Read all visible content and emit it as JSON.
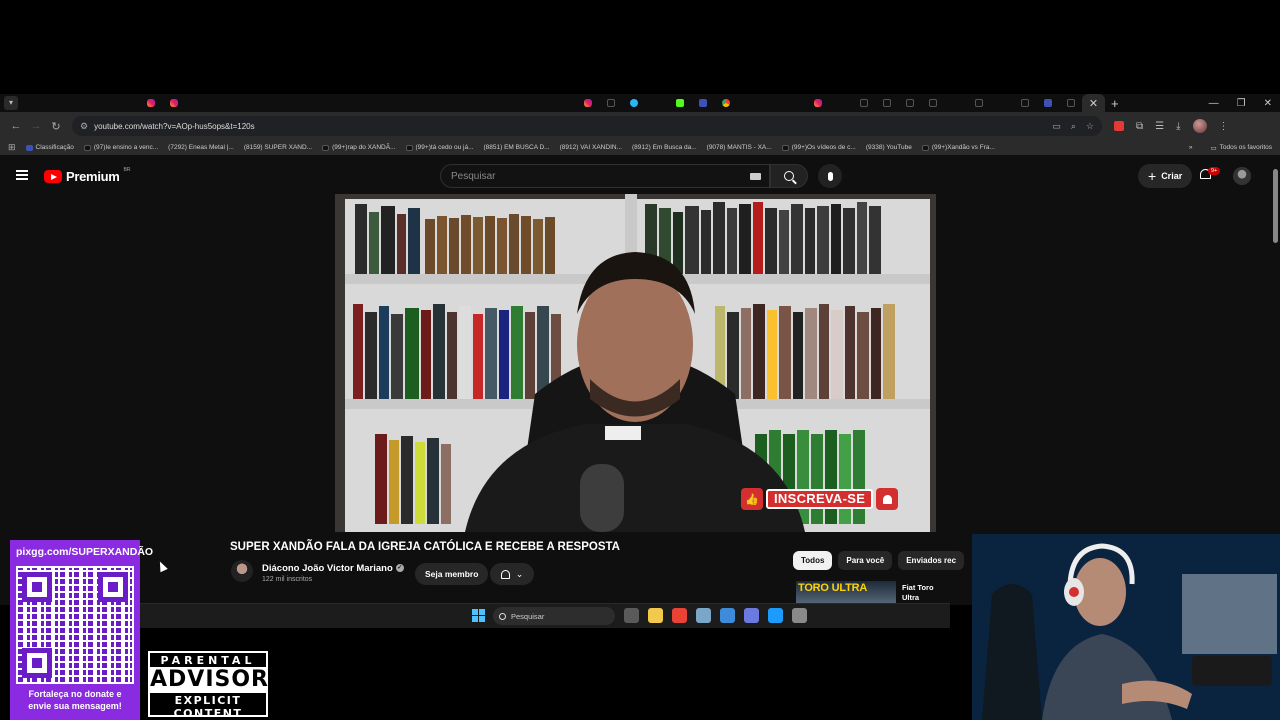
{
  "browser": {
    "tabs": [
      "yt",
      "yt",
      "yt",
      "yt",
      "yt",
      "ig",
      "ig",
      "yt",
      "yt",
      "yt",
      "yt",
      "yt",
      "yt",
      "yt",
      "yt",
      "yt",
      "yt",
      "yt",
      "yt",
      "yt",
      "yt",
      "yt",
      "yt",
      "yt",
      "ig",
      "tk",
      "tg",
      "yt",
      "kk",
      "bl",
      "cr",
      "yt",
      "yt",
      "yt",
      "ig",
      "yt",
      "tk",
      "tk",
      "tk",
      "tk",
      "yt",
      "tk",
      "yt",
      "tk",
      "bl",
      "tk"
    ],
    "url": "youtube.com/watch?v=AOp-hus5ops&t=120s",
    "bookmarks": [
      {
        "icon": "bl",
        "label": "Classificação"
      },
      {
        "icon": "tk",
        "label": "(97)Ie ensino a venc..."
      },
      {
        "icon": "yt",
        "label": "(7292) Eneas Metal |..."
      },
      {
        "icon": "yt",
        "label": "(8159) SUPER XAND..."
      },
      {
        "icon": "tk",
        "label": "(99+)rap do XANDÃ..."
      },
      {
        "icon": "tk",
        "label": "(99+)tá cedo ou já..."
      },
      {
        "icon": "yt",
        "label": "(8851) EM BUSCA D..."
      },
      {
        "icon": "yt",
        "label": "(8912) VAI XANDIN..."
      },
      {
        "icon": "yt",
        "label": "(8912) Em Busca da..."
      },
      {
        "icon": "yt",
        "label": "(9078) MANTIS - XA..."
      },
      {
        "icon": "tk",
        "label": "(99+)Os vídeos de c..."
      },
      {
        "icon": "yt",
        "label": "(9338) YouTube"
      },
      {
        "icon": "tk",
        "label": "(99+)Xandão vs Fra..."
      }
    ],
    "all_bookmarks_label": "Todos os favoritos",
    "overflow": "»"
  },
  "youtube": {
    "logo_text": "Premium",
    "logo_sup": "BR",
    "search_placeholder": "Pesquisar",
    "create_label": "Criar",
    "notif_count": "9+",
    "subscribe_overlay": "INSCREVA-SE",
    "video_title": "SUPER XANDÃO FALA DA IGREJA CATÓLICA E RECEBE A RESPOSTA",
    "channel_name": "Diácono João Victor Mariano",
    "channel_subs": "122 mil inscritos",
    "member_label": "Seja membro",
    "chips": [
      "Todos",
      "Para você",
      "Enviados rec"
    ],
    "rec_thumb_text": "TORO ULTRA",
    "rec_title": "Fiat Toro Ultra RAMPAGE o"
  },
  "taskbar": {
    "search_placeholder": "Pesquisar",
    "icons": [
      "#5a5a5a",
      "#f2c94c",
      "#ea4335",
      "#7aa7c7",
      "#3d8bd9",
      "#6c7ae0",
      "#1b9cfc",
      "#8a8a8a"
    ]
  },
  "overlay": {
    "donate_url": "pixgg.com/SUPERXANDÃO",
    "donate_msg_1": "Fortaleça no donate e",
    "donate_msg_2": "envie sua mensagem!",
    "advisory_1": "PARENTAL",
    "advisory_2": "ADVISORY",
    "advisory_3": "EXPLICIT CONTENT"
  }
}
